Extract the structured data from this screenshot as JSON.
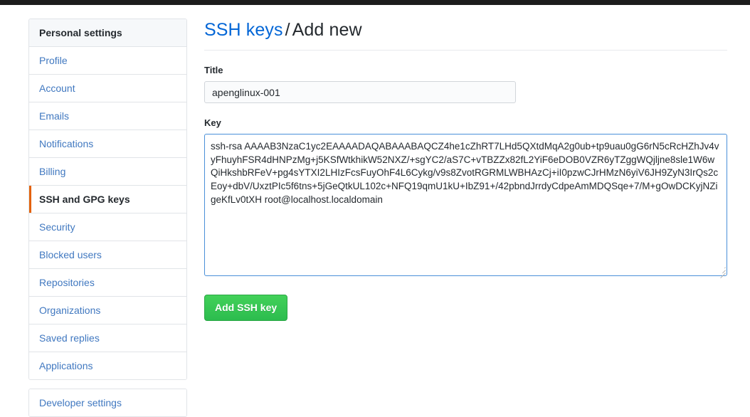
{
  "sidebar": {
    "header": "Personal settings",
    "items": [
      {
        "label": "Profile",
        "selected": false
      },
      {
        "label": "Account",
        "selected": false
      },
      {
        "label": "Emails",
        "selected": false
      },
      {
        "label": "Notifications",
        "selected": false
      },
      {
        "label": "Billing",
        "selected": false
      },
      {
        "label": "SSH and GPG keys",
        "selected": true
      },
      {
        "label": "Security",
        "selected": false
      },
      {
        "label": "Blocked users",
        "selected": false
      },
      {
        "label": "Repositories",
        "selected": false
      },
      {
        "label": "Organizations",
        "selected": false
      },
      {
        "label": "Saved replies",
        "selected": false
      },
      {
        "label": "Applications",
        "selected": false
      }
    ],
    "footer_items": [
      {
        "label": "Developer settings",
        "selected": false
      }
    ]
  },
  "main": {
    "breadcrumb": {
      "link": "SSH keys",
      "separator": "/",
      "current": "Add new"
    },
    "title_field": {
      "label": "Title",
      "value": "apenglinux-001",
      "placeholder": ""
    },
    "key_field": {
      "label": "Key",
      "value": "ssh-rsa AAAAB3NzaC1yc2EAAAADAQABAAABAQCZ4he1cZhRT7LHd5QXtdMqA2g0ub+tp9uau0gG6rN5cRcHZhJv4vyFhuyhFSR4dHNPzMg+j5KSfWtkhikW52NXZ/+sgYC2/aS7C+vTBZZx82fL2YiF6eDOB0VZR6yTZggWQjljne8sle1W6wQiHkshbRFeV+pg4sYTXI2LHIzFcsFuyOhF4L6Cykg/v9s8ZvotRGRMLWBHAzCj+iI0pzwCJrHMzN6yiV6JH9ZyN3IrQs2cEoy+dbV/UxztPIc5f6tns+5jGeQtkUL102c+NFQ19qmU1kU+IbZ91+/42pbndJrrdyCdpeAmMDQSqe+7/M+gOwDCKyjNZigeKfLv0tXH root@localhost.localdomain",
      "placeholder": ""
    },
    "submit_label": "Add SSH key"
  },
  "colors": {
    "link": "#4078c0",
    "heading_link": "#0366d6",
    "selected_marker": "#e36209",
    "button_green": "#35c254",
    "focus_border": "#4a90d9"
  }
}
